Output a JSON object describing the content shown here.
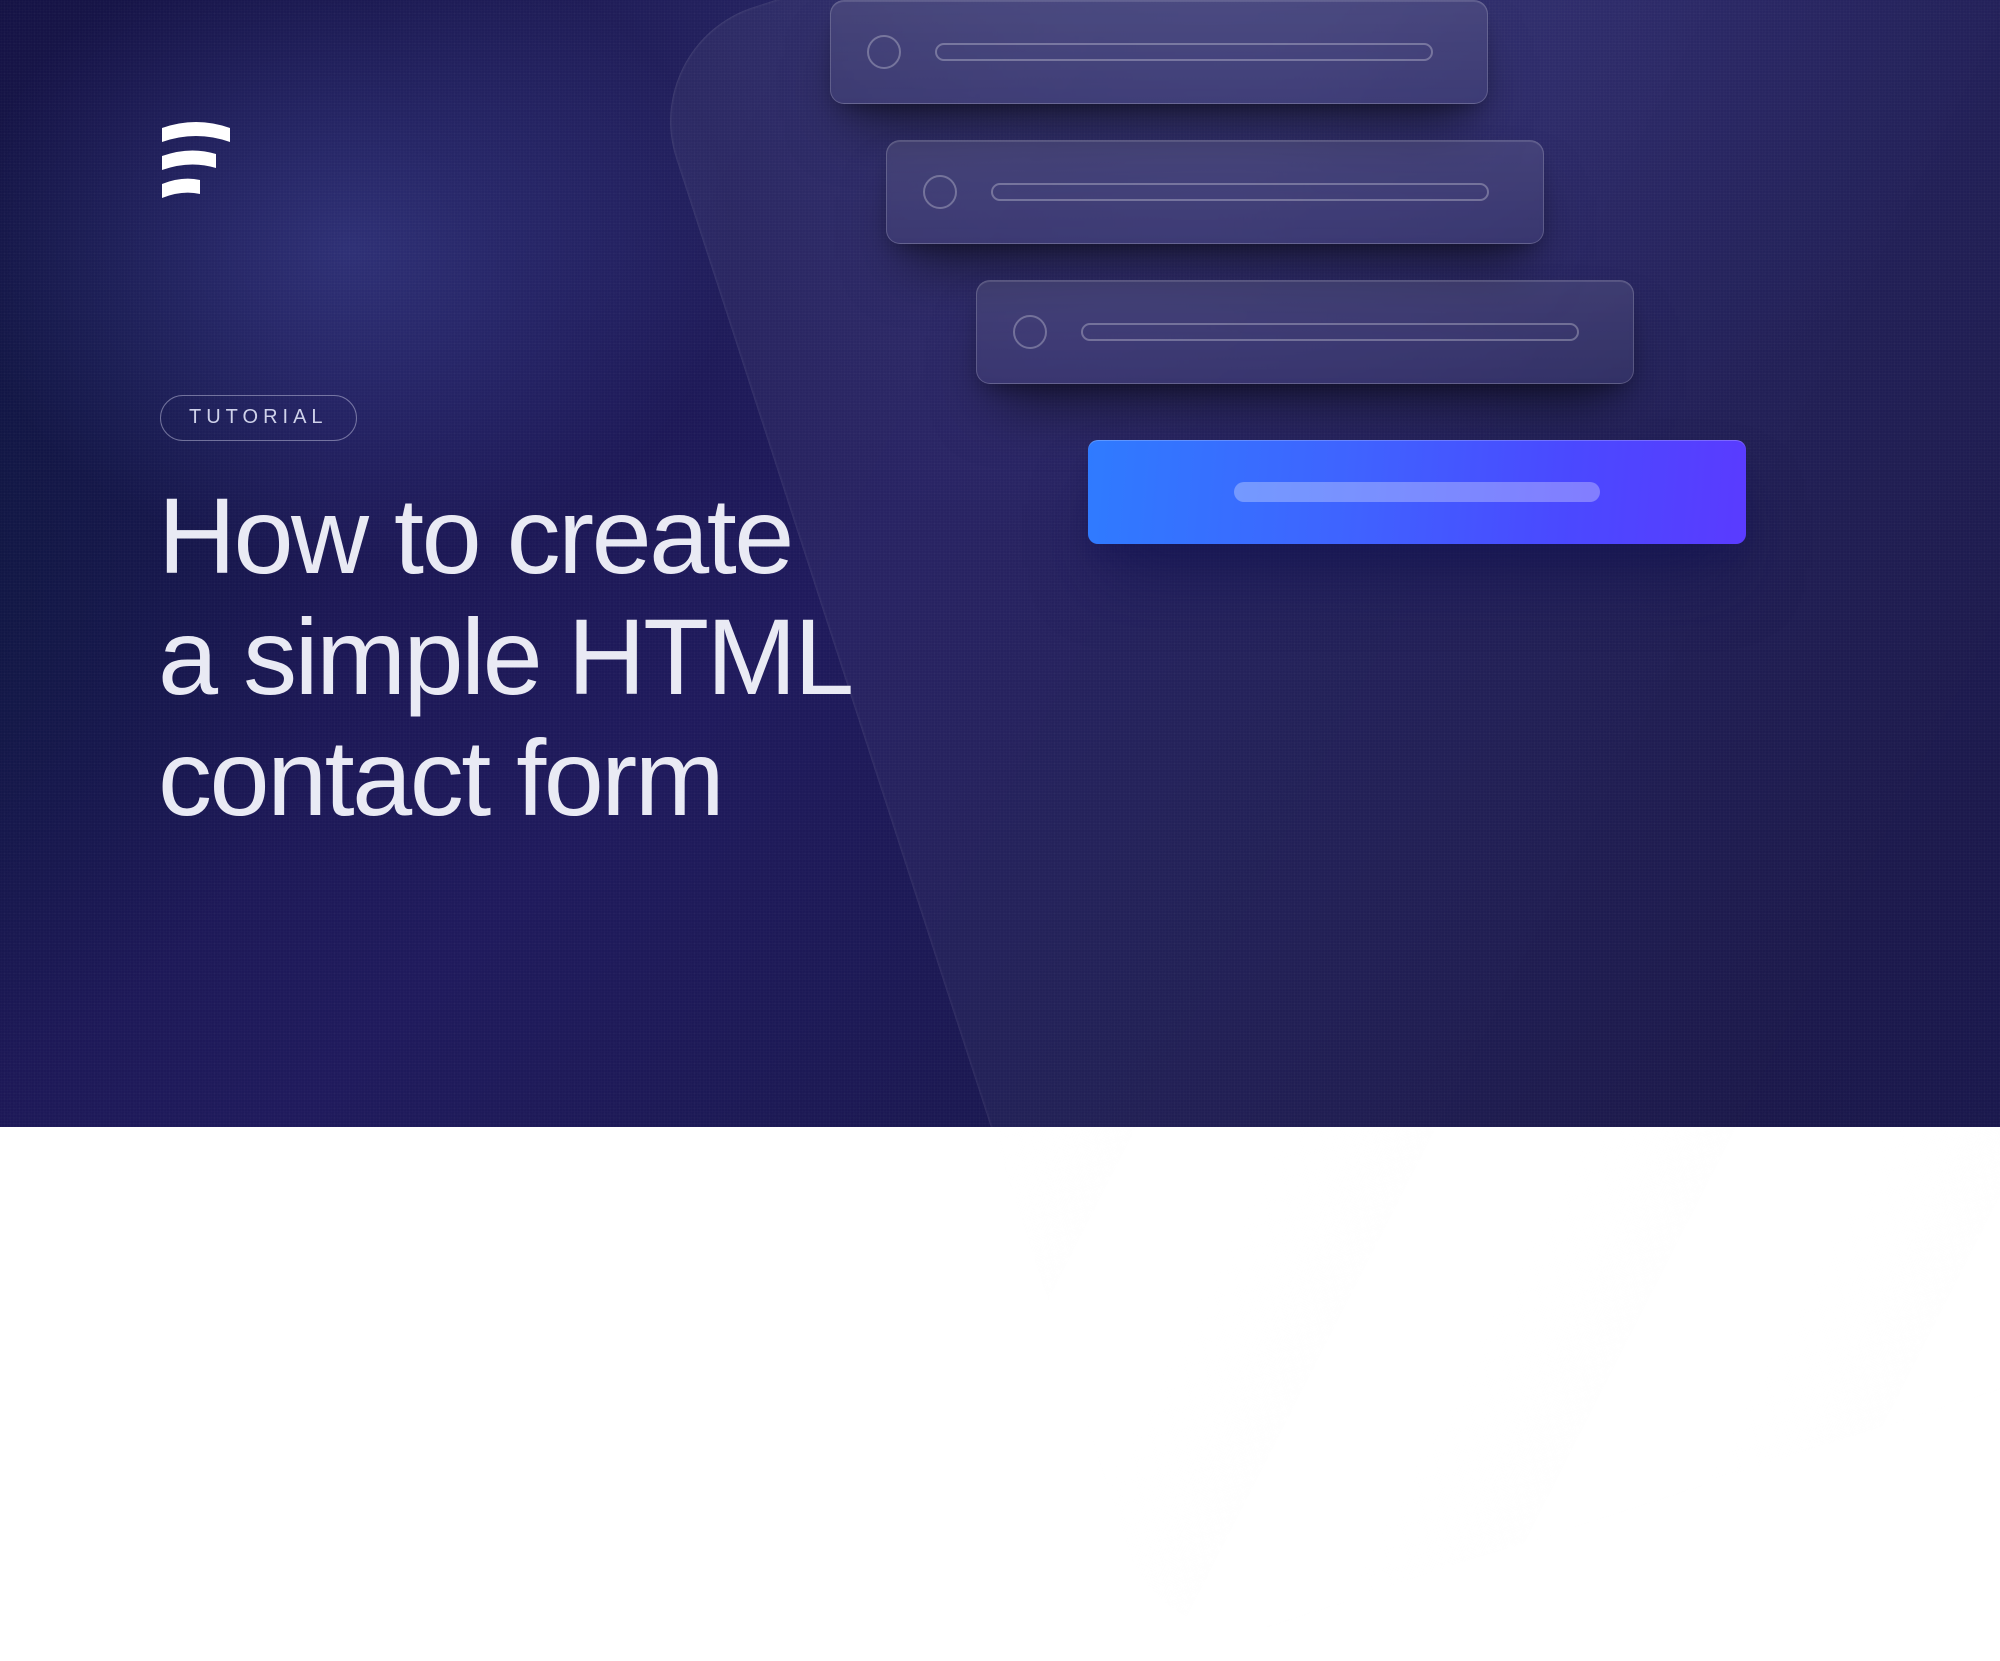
{
  "badge": {
    "label": "TUTORIAL"
  },
  "title": "How to create\na simple HTML\ncontact form",
  "logo_name": "formspark-logo",
  "colors": {
    "bg_start": "#151345",
    "bg_mid": "#1f1a5c",
    "bg_end": "#131042",
    "accent_start": "#2f7bff",
    "accent_end": "#5a3bff",
    "text": "#e9eaf4",
    "muted": "#cfd2ea"
  },
  "illustration": {
    "fields": 3,
    "has_submit": true
  }
}
